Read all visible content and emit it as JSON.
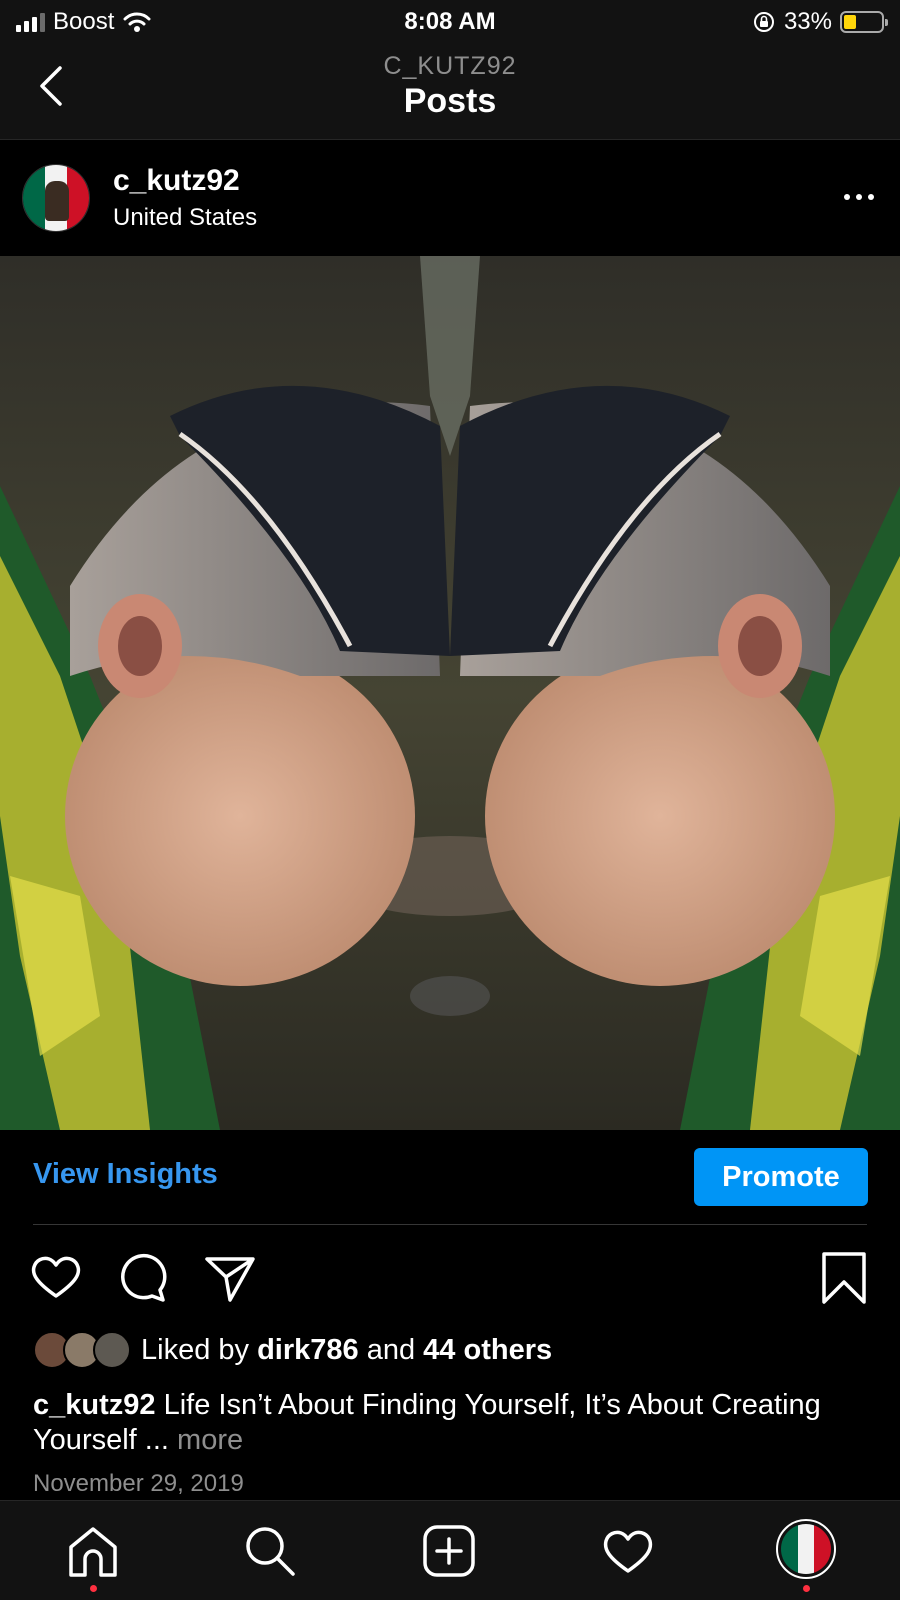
{
  "status_bar": {
    "carrier": "Boost",
    "time": "8:08 AM",
    "battery_percent": "33%",
    "battery_level": 0.33,
    "icons": [
      "signal-icon",
      "wifi-icon",
      "rotation-lock-icon",
      "battery-icon"
    ]
  },
  "header": {
    "subtitle": "C_KUTZ92",
    "title": "Posts",
    "back_icon": "chevron-left-icon"
  },
  "post": {
    "username": "c_kutz92",
    "location": "United States",
    "more_icon": "ellipsis-icon",
    "image_alt": "Mirrored photo of a man's high fade haircut with hard part"
  },
  "insights": {
    "view_insights_label": "View Insights",
    "promote_label": "Promote",
    "accent_color": "#0095f6"
  },
  "actions": {
    "icons": [
      "heart-icon",
      "comment-icon",
      "share-icon",
      "bookmark-icon"
    ]
  },
  "likes": {
    "prefix": "Liked by",
    "user": "dirk786",
    "and": "and",
    "others": "44 others"
  },
  "caption": {
    "username": "c_kutz92",
    "text": "Life Isn’t About Finding Yourself, It’s About Creating Yourself",
    "ellipsis": "...",
    "more": "more"
  },
  "date": "November 29, 2019",
  "tab_bar": {
    "icons": [
      "home-icon",
      "search-icon",
      "new-post-icon",
      "activity-icon",
      "profile-avatar"
    ]
  }
}
